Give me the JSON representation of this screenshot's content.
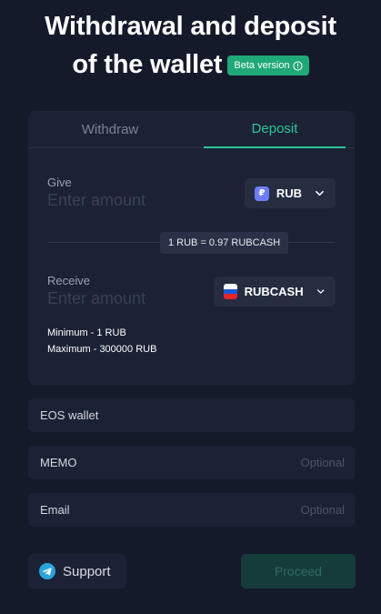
{
  "header": {
    "title_line1": "Withdrawal and deposit",
    "title_line2": "of the wallet",
    "beta_label": "Beta version"
  },
  "tabs": [
    {
      "label": "Withdraw",
      "active": false
    },
    {
      "label": "Deposit",
      "active": true
    }
  ],
  "give": {
    "label": "Give",
    "placeholder": "Enter amount",
    "currency": "RUB",
    "currency_icon_glyph": "₽"
  },
  "rate": "1 RUB = 0.97 RUBCASH",
  "receive": {
    "label": "Receive",
    "placeholder": "Enter amount",
    "currency": "RUBCASH"
  },
  "limits": {
    "minimum": "Minimum - 1 RUB",
    "maximum": "Maximum - 300000 RUB"
  },
  "fields": {
    "eos_wallet": {
      "label": "EOS wallet"
    },
    "memo": {
      "label": "MEMO",
      "hint": "Optional"
    },
    "email": {
      "label": "Email",
      "hint": "Optional"
    }
  },
  "actions": {
    "support_label": "Support",
    "proceed_label": "Proceed"
  },
  "colors": {
    "background": "#151a2b",
    "card": "#1c2235",
    "accent": "#2fc497",
    "beta_badge": "#1fa878",
    "proceed_disabled": "#163b3b"
  },
  "icons": {
    "beta_info": "info-circle-icon",
    "rub_coin": "ruble-coin-icon",
    "rubcash_flag": "russia-flag-icon",
    "dropdown": "chevron-down-icon",
    "support": "telegram-icon"
  }
}
